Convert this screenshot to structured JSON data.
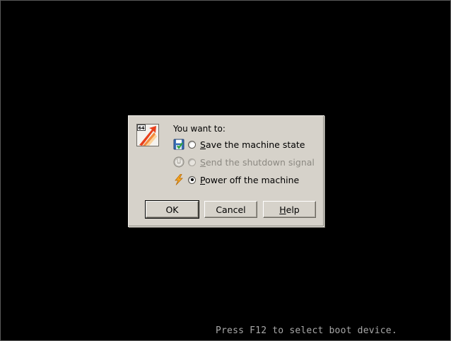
{
  "dialog": {
    "app_icon": "virtualbox-64-icon",
    "prompt": "You want to:",
    "options": [
      {
        "icon": "save-state-icon",
        "label_mnemonic": "S",
        "label_rest": "ave the machine state",
        "selected": false,
        "enabled": true
      },
      {
        "icon": "acpi-shutdown-icon",
        "label_mnemonic": "S",
        "label_rest": "end the shutdown signal",
        "selected": false,
        "enabled": false
      },
      {
        "icon": "power-off-icon",
        "label_mnemonic": "P",
        "label_rest": "ower off the machine",
        "selected": true,
        "enabled": true
      }
    ],
    "buttons": {
      "ok": "OK",
      "cancel": "Cancel",
      "help_mnemonic": "H",
      "help_rest": "elp"
    }
  },
  "boot_message": "Press F12 to select boot device.",
  "colors": {
    "background": "#000000",
    "dialog_bg": "#d6d2ca",
    "boot_text": "#a8a8a8"
  }
}
